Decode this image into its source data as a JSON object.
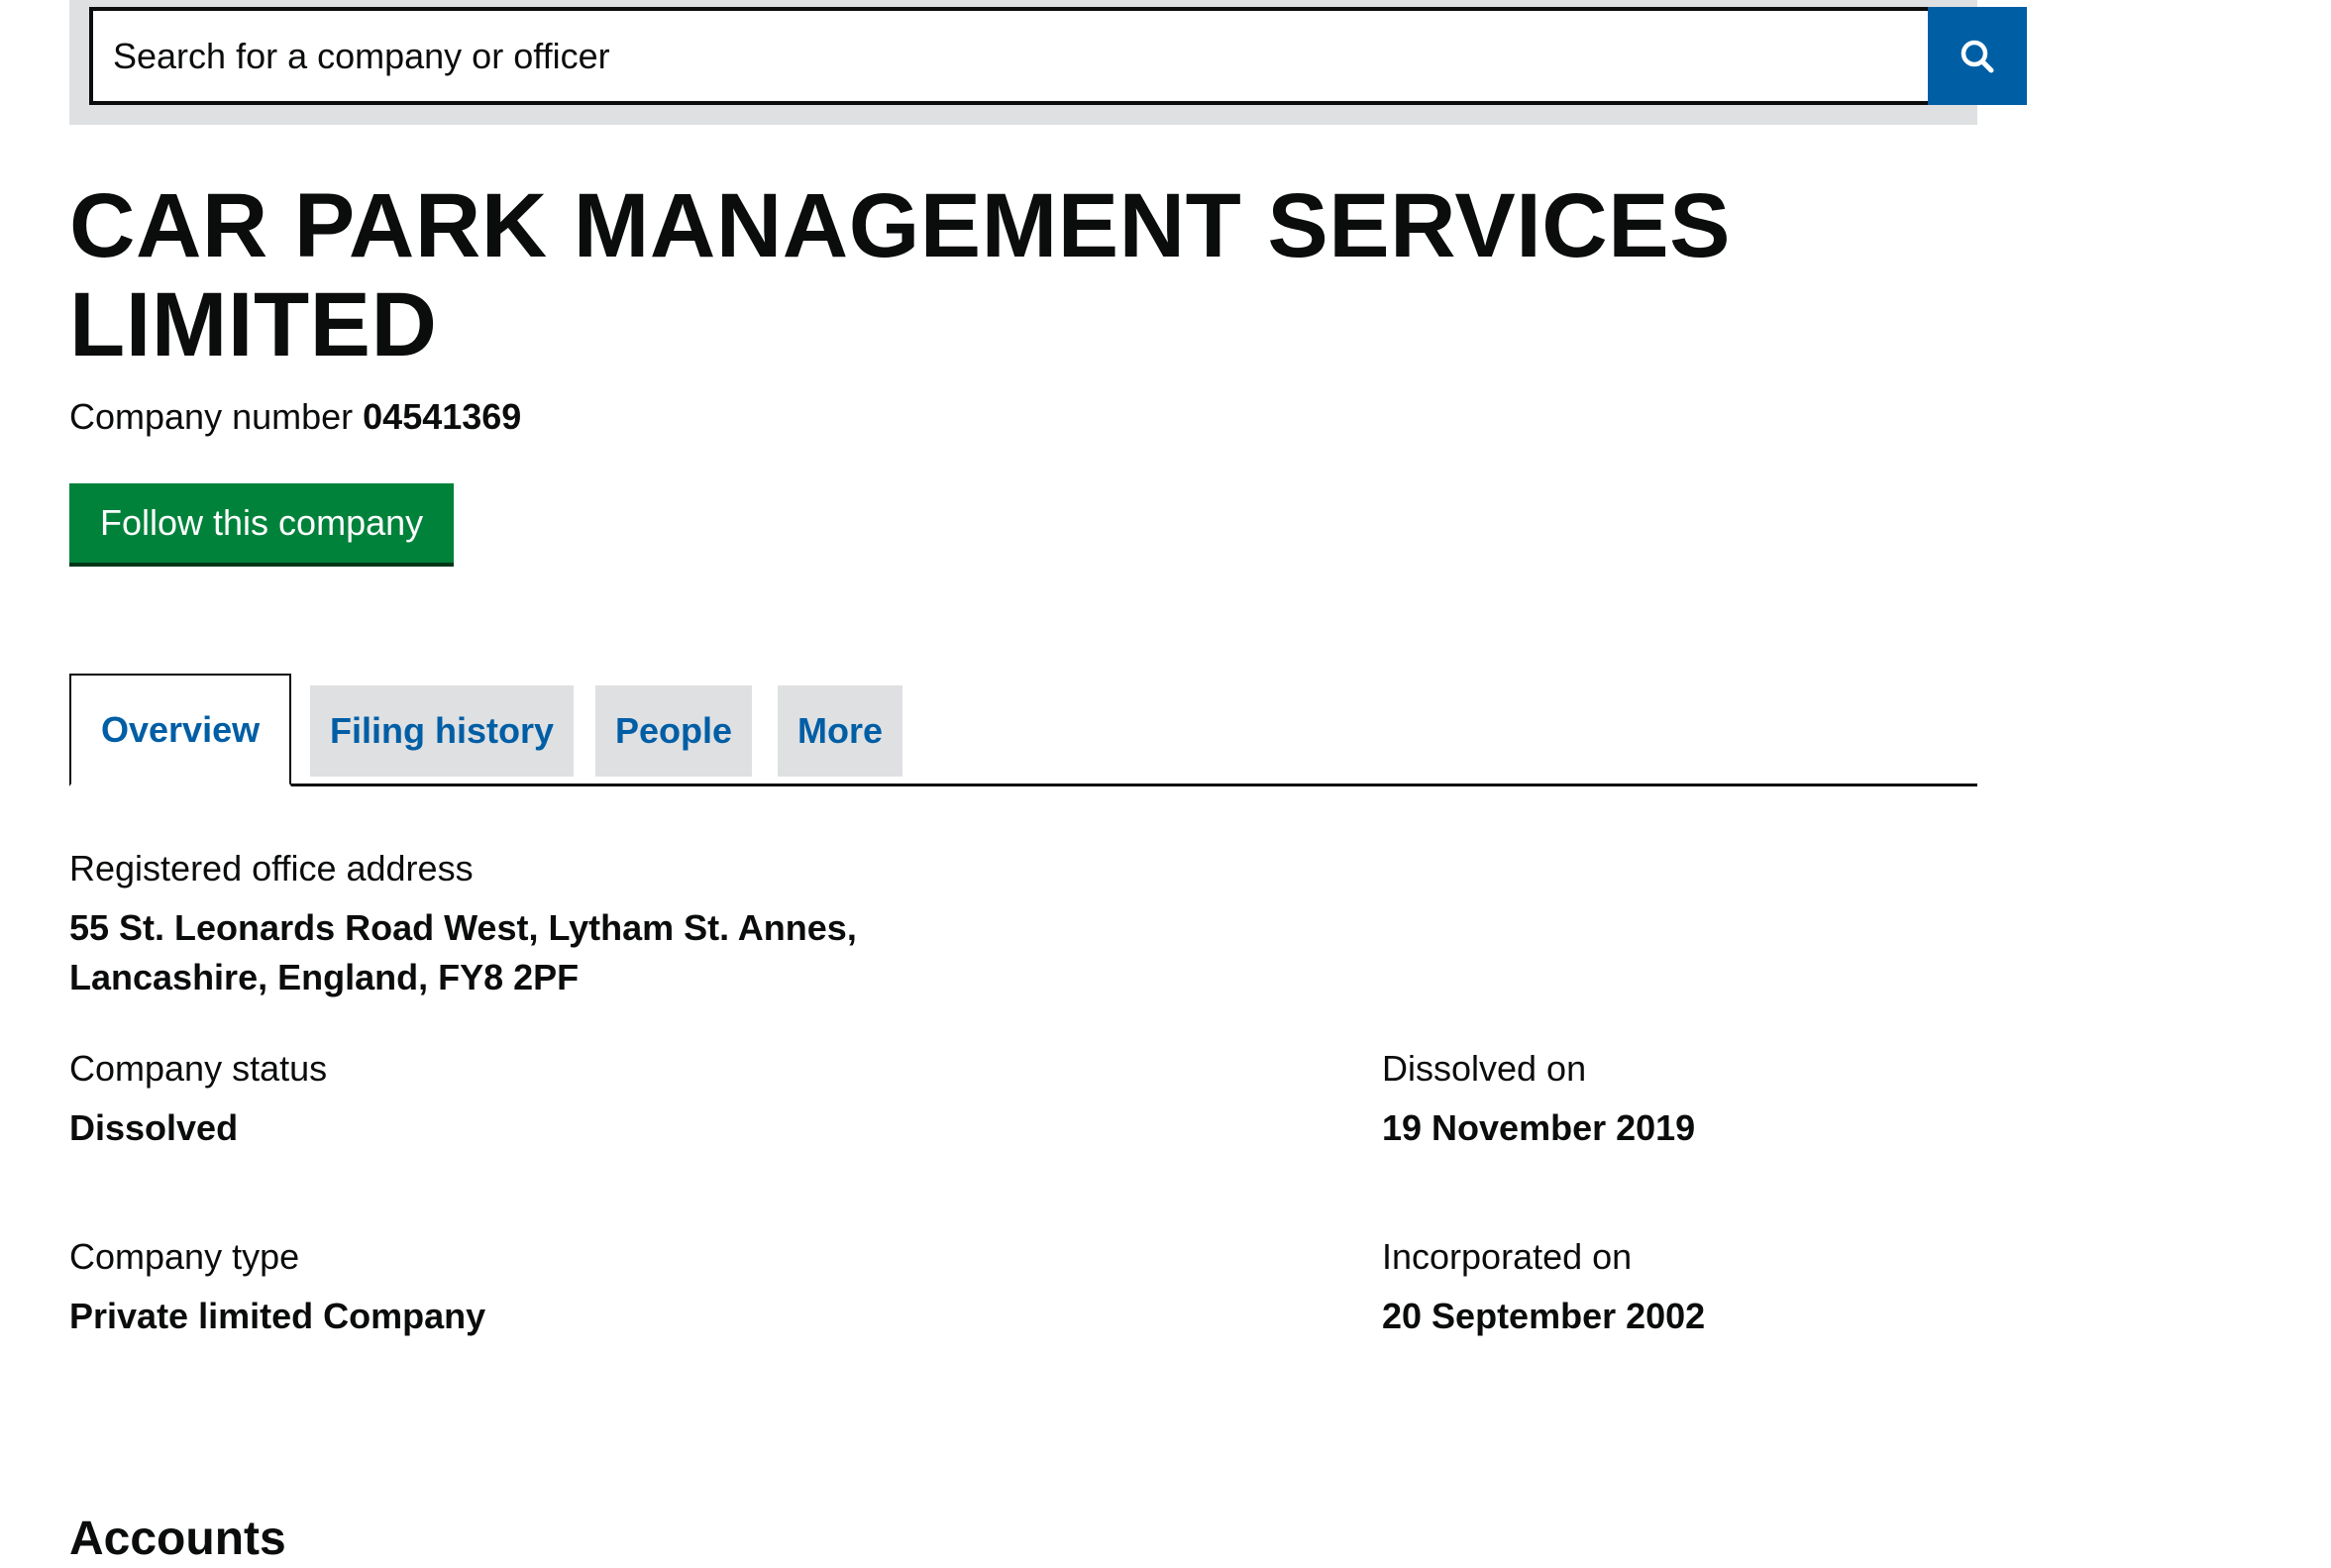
{
  "search": {
    "placeholder": "Search for a company or officer",
    "button_icon": "search-icon"
  },
  "company": {
    "name": "CAR PARK MANAGEMENT SERVICES LIMITED",
    "number_label": "Company number",
    "number": "04541369",
    "follow_label": "Follow this company"
  },
  "tabs": [
    {
      "label": "Overview",
      "active": true
    },
    {
      "label": "Filing history",
      "active": false
    },
    {
      "label": "People",
      "active": false
    },
    {
      "label": "More",
      "active": false
    }
  ],
  "details": {
    "address_label": "Registered office address",
    "address_value": "55 St. Leonards Road West, Lytham St. Annes, Lancashire, England, FY8 2PF",
    "status_label": "Company status",
    "status_value": "Dissolved",
    "dissolved_label": "Dissolved on",
    "dissolved_value": "19 November 2019",
    "type_label": "Company type",
    "type_value": "Private limited Company",
    "incorporated_label": "Incorporated on",
    "incorporated_value": "20 September 2002"
  },
  "sections": {
    "accounts_heading": "Accounts"
  },
  "colors": {
    "link_blue": "#005ea5",
    "button_green": "#00823b",
    "tab_grey": "#dee0e2",
    "text": "#0b0c0c"
  }
}
